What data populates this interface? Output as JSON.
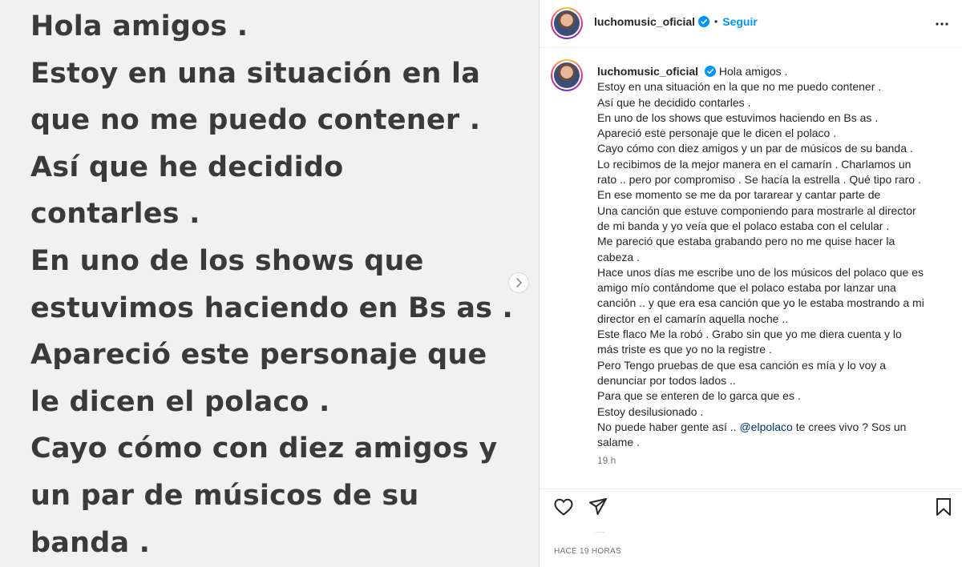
{
  "media": {
    "lines": [
      "Hola amigos .",
      "Estoy en una situación en la",
      "que no me puedo contener .",
      "Así que he decidido",
      "contarles .",
      "En uno de los shows que",
      "estuvimos haciendo en Bs as .",
      "Apareció este  personaje que",
      "le dicen el polaco .",
      "Cayo cómo con diez amigos y",
      "un par de músicos de su",
      "banda ."
    ]
  },
  "header": {
    "username": "luchomusic_oficial",
    "separator": "•",
    "follow_label": "Seguir"
  },
  "caption": {
    "username": "luchomusic_oficial",
    "first_line": "Hola amigos .",
    "lines": [
      "Estoy en una situación en la que no me puedo contener .",
      "Así que he decidido contarles .",
      "En uno de los shows que estuvimos haciendo en Bs as .",
      "Apareció este personaje que le dicen el polaco .",
      "Cayo cómo con diez amigos y un par de músicos de su banda .",
      "Lo recibimos de la mejor manera en el camarín . Charlamos un",
      "rato .. pero por compromiso . Se hacía la estrella . Qué tipo raro .",
      "En ese momento se me da por tararear y cantar parte de",
      "Una canción que estuve componiendo para mostrarle al director",
      "de mi banda y yo veía que el polaco estaba con el celular .",
      "Me pareció que estaba grabando pero no me quise hacer la",
      "cabeza .",
      "Hace unos días me escribe uno de los músicos del polaco que es",
      "amigo mío contándome que el polaco estaba por lanzar una",
      "canción .. y que era esa canción que yo le estaba mostrando a mi",
      "director en el camarín aquella noche ..",
      "Este flaco Me la robó . Grabo sin que yo me diera cuenta y lo",
      "más triste es que yo no la registre .",
      "Pero Tengo pruebas de que esa canción es mía y lo voy a",
      "denunciar por todos lados ..",
      "Para que se enteren de lo garca que es .",
      "Estoy desilusionado ."
    ],
    "last_line_before": "No puede haber gente así .. ",
    "mention": "@elpolaco",
    "last_line_after": " te crees vivo ? Sos un",
    "final_line": "salame .",
    "timestamp": "19 h"
  },
  "footer": {
    "time_ago": "HACE 19 HORAS"
  },
  "colors": {
    "accent": "#0095f6",
    "verified": "#0095f6",
    "mention": "#00376b"
  }
}
